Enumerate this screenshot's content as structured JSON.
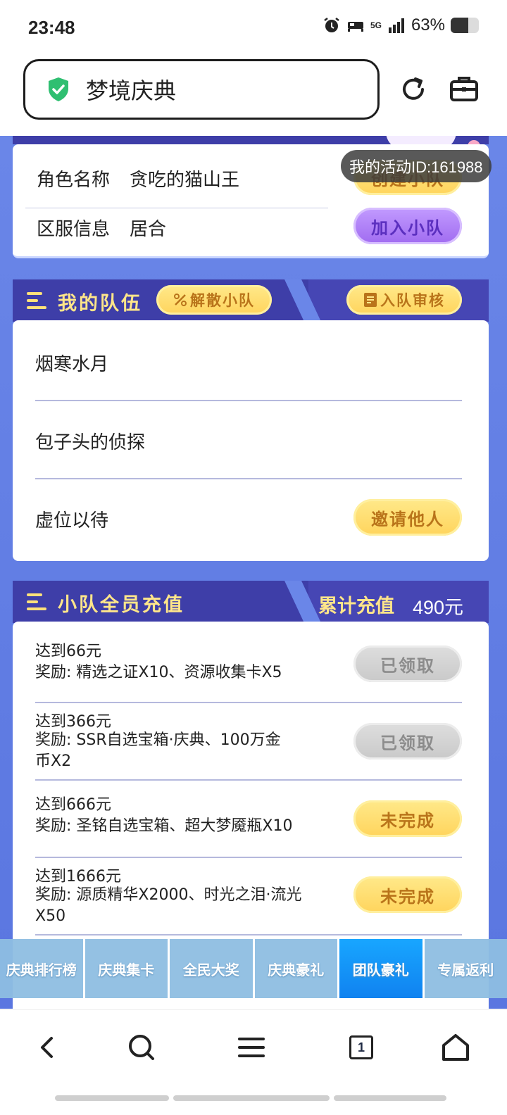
{
  "status_bar": {
    "time": "23:48",
    "network": "5G",
    "battery": "63%",
    "battery_level": 0.63
  },
  "browser": {
    "url_title": "梦境庆典",
    "secure_icon": "shield-check-icon"
  },
  "profile": {
    "role_label": "角色名称",
    "role_value": "贪吃的猫山王",
    "server_label": "区服信息",
    "server_value": "居合",
    "create_team": "创建小队",
    "join_team": "加入小队",
    "activity_id": "我的活动ID:161988"
  },
  "my_team": {
    "title": "我的队伍",
    "disband": "解散小队",
    "review": "入队审核",
    "members": [
      "烟寒水月",
      "包子头的侦探",
      "虚位以待"
    ],
    "invite": "邀请他人"
  },
  "recharge": {
    "title": "小队全员充值",
    "cumulative_label": "累计充值",
    "cumulative_value": "490元",
    "tiers": [
      {
        "target": "达到66元",
        "reward": "奖励: 精选之证X10、资源收集卡X5",
        "status": "已领取",
        "state": "claimed"
      },
      {
        "target": "达到366元",
        "reward": "奖励: SSR自选宝箱·庆典、100万金币X2",
        "status": "已领取",
        "state": "claimed"
      },
      {
        "target": "达到666元",
        "reward": "奖励: 圣铭自选宝箱、超大梦魇瓶X10",
        "status": "未完成",
        "state": "incomplete"
      },
      {
        "target": "达到1666元",
        "reward": "奖励: 源质精华X2000、时光之泪·流光X50",
        "status": "未完成",
        "state": "incomplete"
      }
    ]
  },
  "tabs": [
    {
      "label": "庆典排行榜",
      "active": false
    },
    {
      "label": "庆典集卡",
      "active": false
    },
    {
      "label": "全民大奖",
      "active": false
    },
    {
      "label": "庆典豪礼",
      "active": false
    },
    {
      "label": "团队豪礼",
      "active": true
    },
    {
      "label": "专属返利",
      "active": false
    }
  ],
  "bottom_nav": [
    "back-icon",
    "search-icon",
    "menu-icon",
    "tabs-icon",
    "home-icon"
  ],
  "tab_count": "1"
}
